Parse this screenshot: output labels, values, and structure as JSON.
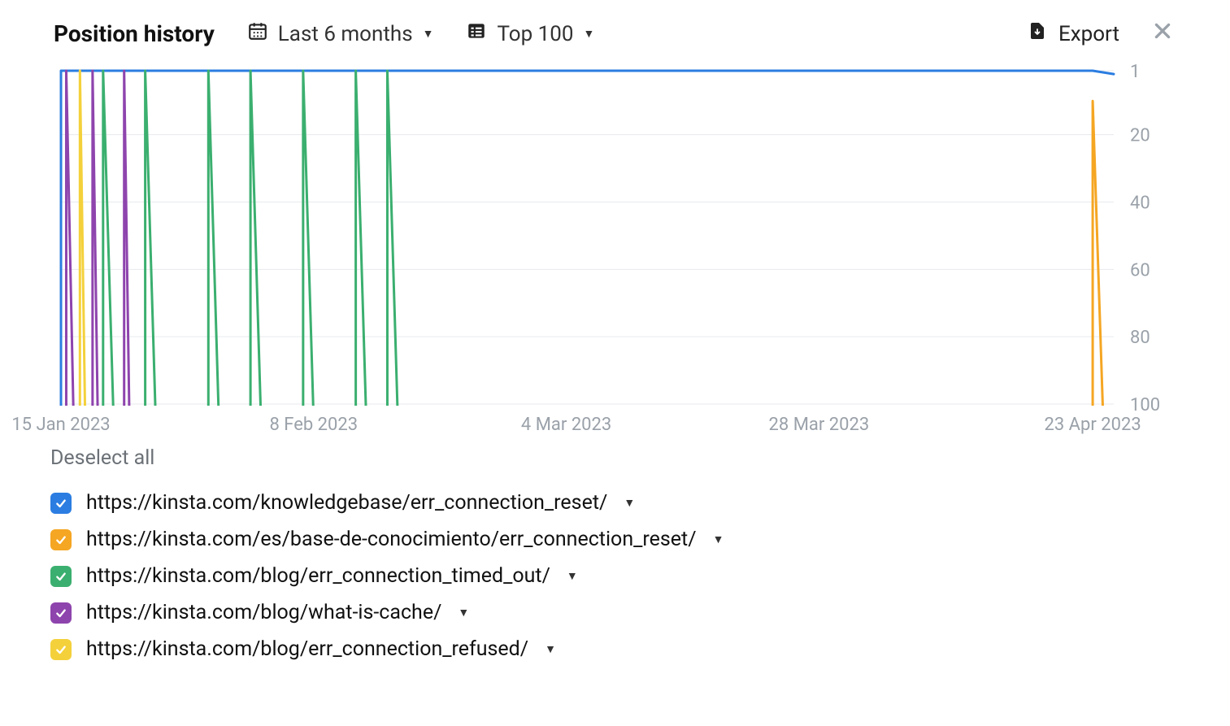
{
  "header": {
    "title": "Position history",
    "date_range_label": "Last 6 months",
    "top_label": "Top 100",
    "export_label": "Export"
  },
  "legend": {
    "deselect_label": "Deselect all",
    "items": [
      {
        "color": "#2B7DE1",
        "url": "https://kinsta.com/knowledgebase/err_connection_reset/",
        "checked": true
      },
      {
        "color": "#F5A623",
        "url": "https://kinsta.com/es/base-de-conocimiento/err_connection_reset/",
        "checked": true
      },
      {
        "color": "#3BAF6F",
        "url": "https://kinsta.com/blog/err_connection_timed_out/",
        "checked": true
      },
      {
        "color": "#8E44AD",
        "url": "https://kinsta.com/blog/what-is-cache/",
        "checked": true
      },
      {
        "color": "#F4D13B",
        "url": "https://kinsta.com/blog/err_connection_refused/",
        "checked": true
      }
    ]
  },
  "chart_data": {
    "type": "line",
    "title": "Position history",
    "xlabel": "",
    "ylabel": "",
    "ylim": [
      1,
      100
    ],
    "y_ticks": [
      1,
      20,
      40,
      60,
      80,
      100
    ],
    "x_ticks": [
      "15 Jan 2023",
      "8 Feb 2023",
      "4 Mar 2023",
      "28 Mar 2023",
      "23 Apr 2023"
    ],
    "x_range_days": [
      0,
      100
    ],
    "note": "Y axis is inverted: position 1 at top, 100 at bottom. null = not in top 100 (no point drawn).",
    "series": [
      {
        "name": "https://kinsta.com/knowledgebase/err_connection_reset/",
        "color": "#2B7DE1",
        "points": [
          {
            "d": 0,
            "p": 1
          },
          {
            "d": 5,
            "p": 1
          },
          {
            "d": 10,
            "p": 1
          },
          {
            "d": 15,
            "p": 1
          },
          {
            "d": 20,
            "p": 1
          },
          {
            "d": 25,
            "p": 1
          },
          {
            "d": 30,
            "p": 1
          },
          {
            "d": 35,
            "p": 1
          },
          {
            "d": 40,
            "p": 1
          },
          {
            "d": 45,
            "p": 1
          },
          {
            "d": 50,
            "p": 1
          },
          {
            "d": 55,
            "p": 1
          },
          {
            "d": 60,
            "p": 1
          },
          {
            "d": 65,
            "p": 1
          },
          {
            "d": 70,
            "p": 1
          },
          {
            "d": 75,
            "p": 1
          },
          {
            "d": 80,
            "p": 1
          },
          {
            "d": 85,
            "p": 1
          },
          {
            "d": 90,
            "p": 1
          },
          {
            "d": 95,
            "p": 1
          },
          {
            "d": 98,
            "p": 1
          },
          {
            "d": 100,
            "p": 2
          }
        ]
      },
      {
        "name": "https://kinsta.com/es/base-de-conocimiento/err_connection_reset/",
        "color": "#F5A623",
        "points": [
          {
            "d": 0,
            "p": null
          },
          {
            "d": 95,
            "p": null
          },
          {
            "d": 97,
            "p": null
          },
          {
            "d": 98,
            "p": 10
          },
          {
            "d": 99,
            "p": null
          },
          {
            "d": 100,
            "p": null
          }
        ]
      },
      {
        "name": "https://kinsta.com/blog/err_connection_timed_out/",
        "color": "#3BAF6F",
        "points": [
          {
            "d": 0,
            "p": null
          },
          {
            "d": 3,
            "p": null
          },
          {
            "d": 4,
            "p": 1
          },
          {
            "d": 5,
            "p": null
          },
          {
            "d": 7,
            "p": null
          },
          {
            "d": 8,
            "p": 1
          },
          {
            "d": 9,
            "p": null
          },
          {
            "d": 13,
            "p": null
          },
          {
            "d": 14,
            "p": 1
          },
          {
            "d": 15,
            "p": null
          },
          {
            "d": 17,
            "p": null
          },
          {
            "d": 18,
            "p": 1
          },
          {
            "d": 19,
            "p": null
          },
          {
            "d": 22,
            "p": null
          },
          {
            "d": 23,
            "p": 1
          },
          {
            "d": 24,
            "p": null
          },
          {
            "d": 27,
            "p": null
          },
          {
            "d": 28,
            "p": 1
          },
          {
            "d": 29,
            "p": null
          },
          {
            "d": 30,
            "p": null
          },
          {
            "d": 31,
            "p": 1
          },
          {
            "d": 32,
            "p": null
          },
          {
            "d": 100,
            "p": null
          }
        ]
      },
      {
        "name": "https://kinsta.com/blog/what-is-cache/",
        "color": "#8E44AD",
        "points": [
          {
            "d": 0,
            "p": null
          },
          {
            "d": 0.5,
            "p": 1
          },
          {
            "d": 1.2,
            "p": null
          },
          {
            "d": 2.5,
            "p": null
          },
          {
            "d": 3,
            "p": 1
          },
          {
            "d": 3.5,
            "p": null
          },
          {
            "d": 5.5,
            "p": null
          },
          {
            "d": 6,
            "p": 1
          },
          {
            "d": 6.5,
            "p": null
          },
          {
            "d": 100,
            "p": null
          }
        ]
      },
      {
        "name": "https://kinsta.com/blog/err_connection_refused/",
        "color": "#F4D13B",
        "points": [
          {
            "d": 0,
            "p": null
          },
          {
            "d": 1.3,
            "p": null
          },
          {
            "d": 1.8,
            "p": 1
          },
          {
            "d": 2.3,
            "p": null
          },
          {
            "d": 100,
            "p": null
          }
        ]
      }
    ]
  }
}
